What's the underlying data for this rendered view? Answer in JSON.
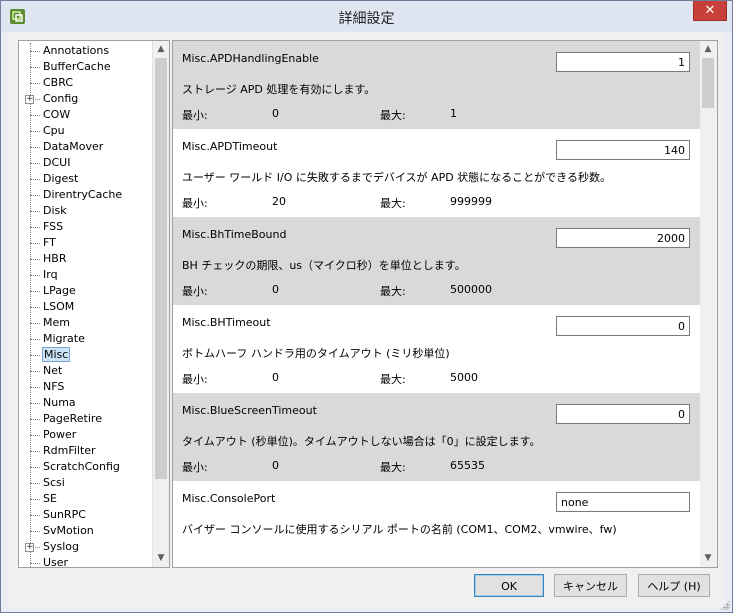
{
  "window": {
    "title": "詳細設定",
    "close_label": "✕"
  },
  "tree": {
    "items": [
      {
        "label": "Annotations",
        "expandable": false
      },
      {
        "label": "BufferCache",
        "expandable": false
      },
      {
        "label": "CBRC",
        "expandable": false
      },
      {
        "label": "Config",
        "expandable": true
      },
      {
        "label": "COW",
        "expandable": false
      },
      {
        "label": "Cpu",
        "expandable": false
      },
      {
        "label": "DataMover",
        "expandable": false
      },
      {
        "label": "DCUI",
        "expandable": false
      },
      {
        "label": "Digest",
        "expandable": false
      },
      {
        "label": "DirentryCache",
        "expandable": false
      },
      {
        "label": "Disk",
        "expandable": false
      },
      {
        "label": "FSS",
        "expandable": false
      },
      {
        "label": "FT",
        "expandable": false
      },
      {
        "label": "HBR",
        "expandable": false
      },
      {
        "label": "Irq",
        "expandable": false
      },
      {
        "label": "LPage",
        "expandable": false
      },
      {
        "label": "LSOM",
        "expandable": false
      },
      {
        "label": "Mem",
        "expandable": false
      },
      {
        "label": "Migrate",
        "expandable": false
      },
      {
        "label": "Misc",
        "expandable": false,
        "selected": true
      },
      {
        "label": "Net",
        "expandable": false
      },
      {
        "label": "NFS",
        "expandable": false
      },
      {
        "label": "Numa",
        "expandable": false
      },
      {
        "label": "PageRetire",
        "expandable": false
      },
      {
        "label": "Power",
        "expandable": false
      },
      {
        "label": "RdmFilter",
        "expandable": false
      },
      {
        "label": "ScratchConfig",
        "expandable": false
      },
      {
        "label": "Scsi",
        "expandable": false
      },
      {
        "label": "SE",
        "expandable": false
      },
      {
        "label": "SunRPC",
        "expandable": false
      },
      {
        "label": "SvMotion",
        "expandable": false
      },
      {
        "label": "Syslog",
        "expandable": true
      },
      {
        "label": "User",
        "expandable": false
      }
    ]
  },
  "labels": {
    "min": "最小:",
    "max": "最大:"
  },
  "settings": [
    {
      "name": "Misc.APDHandlingEnable",
      "value": "1",
      "numeric": true,
      "description": "ストレージ APD 処理を有効にします。",
      "min": "0",
      "max": "1"
    },
    {
      "name": "Misc.APDTimeout",
      "value": "140",
      "numeric": true,
      "description": "ユーザー ワールド I/O に失敗するまでデバイスが APD 状態になることができる秒数。",
      "min": "20",
      "max": "999999"
    },
    {
      "name": "Misc.BhTimeBound",
      "value": "2000",
      "numeric": true,
      "description": "BH チェックの期限、us（マイクロ秒）を単位とします。",
      "min": "0",
      "max": "500000"
    },
    {
      "name": "Misc.BHTimeout",
      "value": "0",
      "numeric": true,
      "description": "ボトムハーフ ハンドラ用のタイムアウト (ミリ秒単位)",
      "min": "0",
      "max": "5000"
    },
    {
      "name": "Misc.BlueScreenTimeout",
      "value": "0",
      "numeric": true,
      "description": "タイムアウト (秒単位)。タイムアウトしない場合は「0」に設定します。",
      "min": "0",
      "max": "65535"
    },
    {
      "name": "Misc.ConsolePort",
      "value": "none",
      "numeric": false,
      "description": "バイザー コンソールに使用するシリアル ポートの名前 (COM1、COM2、vmwire、fw)",
      "min": null,
      "max": null
    }
  ],
  "buttons": {
    "ok": "OK",
    "cancel": "キャンセル",
    "help": "ヘルプ (H)"
  }
}
